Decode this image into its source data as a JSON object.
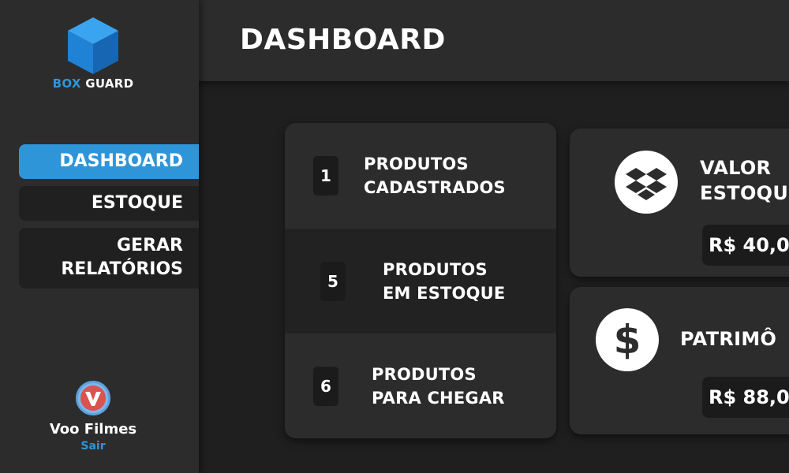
{
  "sidebar": {
    "brand": {
      "part1": "BOX",
      "part2": " GUARD",
      "logo_icon": "blue-cube"
    },
    "nav": [
      {
        "label": "DASHBOARD",
        "active": true
      },
      {
        "label": "ESTOQUE",
        "active": false
      },
      {
        "label": "GERAR\nRELATÓRIOS",
        "active": false
      }
    ],
    "user": {
      "name": "Voo Filmes",
      "avatar_icon": "v-logo",
      "logout_label": "Sair"
    }
  },
  "header": {
    "title": "DASHBOARD"
  },
  "stats": [
    {
      "value": "1",
      "label": "PRODUTOS\nCADASTRADOS"
    },
    {
      "value": "5",
      "label": "PRODUTOS\nEM ESTOQUE"
    },
    {
      "value": "6",
      "label": "PRODUTOS\nPARA CHEGAR"
    }
  ],
  "value_cards": [
    {
      "title": "VALOR\nESTOQU",
      "amount": "R$ 40,0",
      "icon": "dropbox-icon"
    },
    {
      "title": "PATRIMÔ",
      "amount": "R$ 88,0",
      "icon": "dollar-icon"
    }
  ],
  "colors": {
    "accent": "#2f95d9",
    "background": "#1f1f1f",
    "panel": "#2c2c2c"
  }
}
